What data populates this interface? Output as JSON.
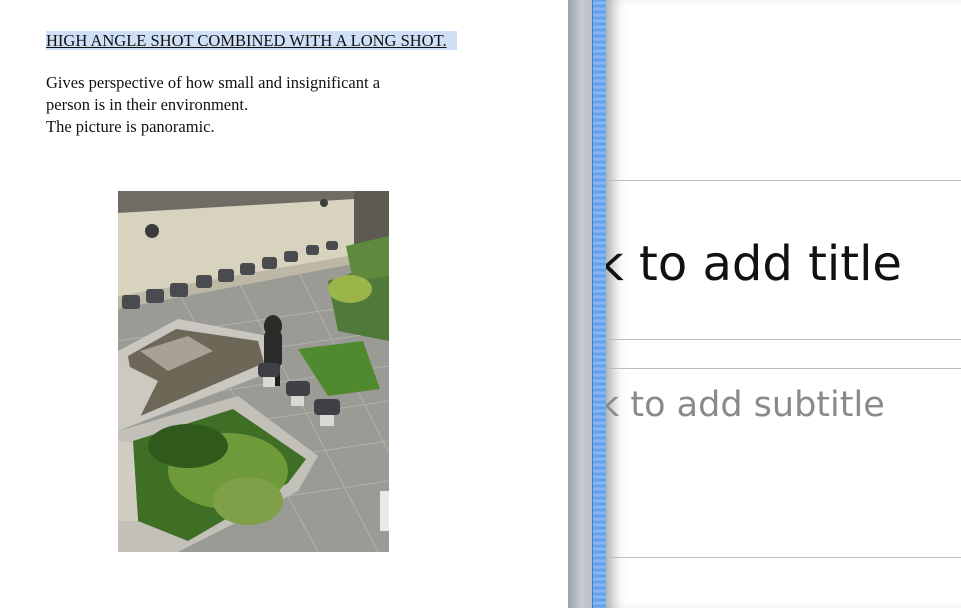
{
  "document": {
    "heading": "HIGH ANGLE SHOT COMBINED WITH A LONG SHOT.",
    "body_lines": [
      "Gives perspective of how small and insignificant a",
      "person is in their environment.",
      "The picture is panoramic."
    ]
  },
  "slide": {
    "title_placeholder": "k to add title",
    "subtitle_placeholder": "k to add subtitle"
  },
  "colors": {
    "selection_highlight": "#cfe0f6",
    "divider_selection": "#5b9ae8",
    "subtitle_text": "#8a8a8a"
  }
}
